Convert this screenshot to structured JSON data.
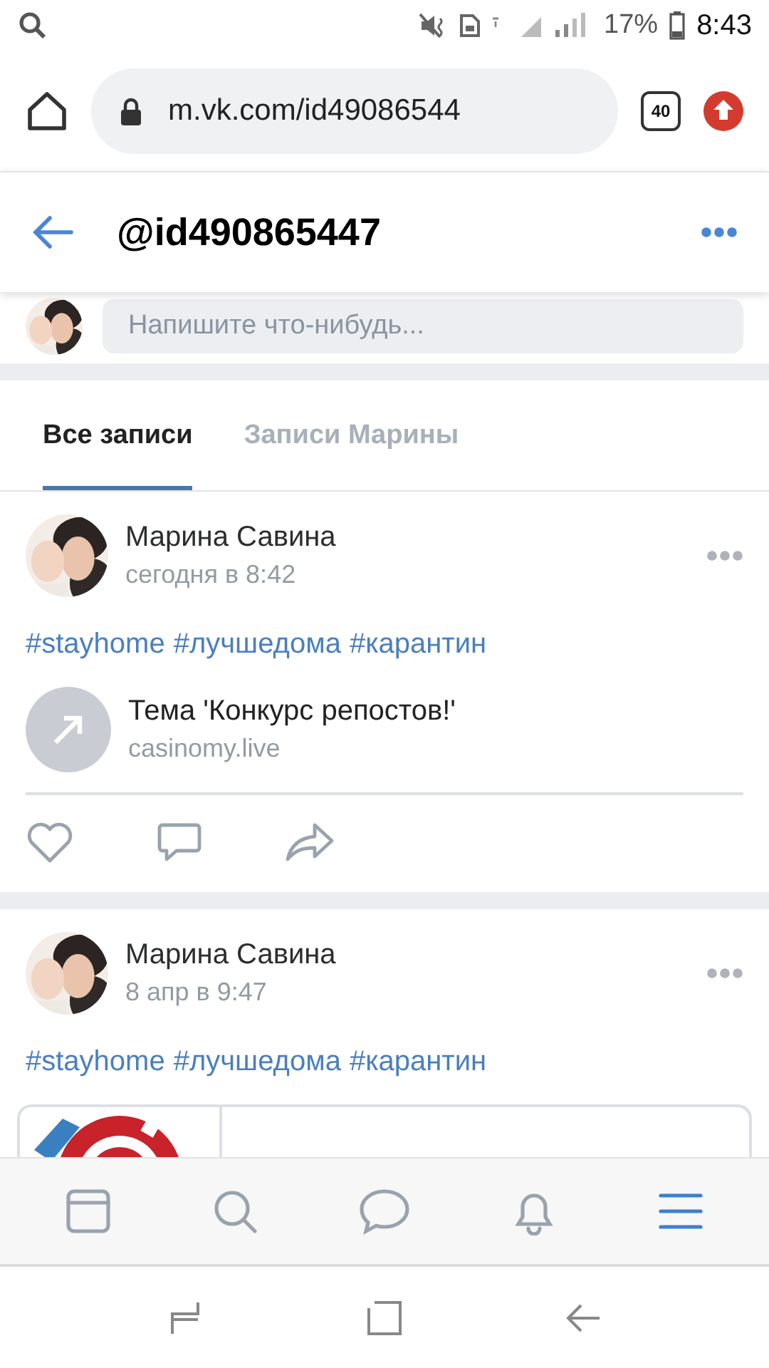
{
  "status_bar": {
    "battery": "17%",
    "time": "8:43"
  },
  "browser": {
    "url": "m.vk.com/id49086544",
    "tab_count": "40"
  },
  "header": {
    "title": "@id490865447"
  },
  "composer": {
    "placeholder": "Напишите что-нибудь..."
  },
  "tabs": [
    {
      "label": "Все записи",
      "selected": true
    },
    {
      "label": "Записи Марины",
      "selected": false
    }
  ],
  "posts": [
    {
      "author": "Марина Савина",
      "time": "сегодня в 8:42",
      "hashtags": [
        "#stayhome",
        "#лучшедома",
        "#карантин"
      ],
      "attachment": {
        "kind": "link",
        "title": "Тема 'Конкурс репостов!'",
        "domain": "casinomy.live"
      }
    },
    {
      "author": "Марина Савина",
      "time": "8 апр в 9:47",
      "hashtags": [
        "#stayhome",
        "#лучшедома",
        "#карантин"
      ],
      "attachment": {
        "kind": "card"
      }
    }
  ],
  "bottom_nav": [
    {
      "selected": false
    },
    {
      "selected": false
    },
    {
      "selected": false
    },
    {
      "selected": false
    },
    {
      "selected": true
    }
  ]
}
